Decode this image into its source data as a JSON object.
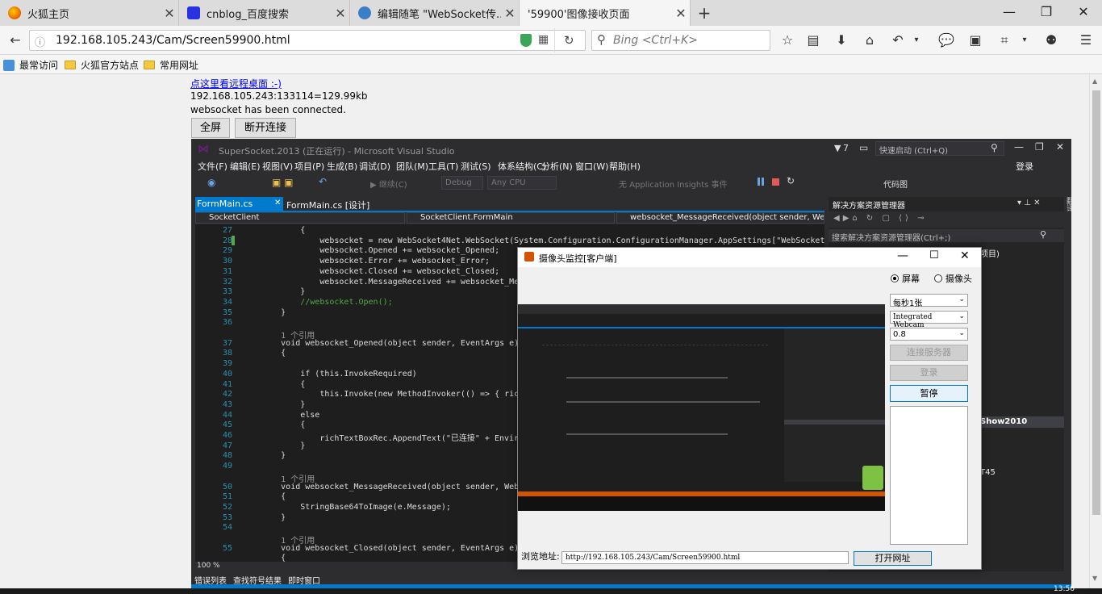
{
  "tabs": [
    {
      "title": "火狐主页",
      "color": "#e66000"
    },
    {
      "title": "cnblog_百度搜索",
      "color": "#2932e1"
    },
    {
      "title": "编辑随笔 \"WebSocket传...",
      "color": "#3b7ec8"
    },
    {
      "title": "'59900'图像接收页面",
      "color": "#cccccc"
    }
  ],
  "nav": {
    "url": "192.168.105.243/Cam/Screen59900.html",
    "search_placeholder": "Bing <Ctrl+K>"
  },
  "bookmarks": [
    "最常访问",
    "火狐官方站点",
    "常用网址"
  ],
  "page": {
    "link": "点这里看远程桌面 :-)",
    "stats": "192.168.105.243:133114=129.99kb",
    "status": "websocket has been connected.",
    "fullscreen_btn": "全屏",
    "disconnect_btn": "断开连接"
  },
  "vs": {
    "title": "SuperSocket.2013 (正在运行) - Microsoft Visual Studio",
    "notif_count": "7",
    "quicklaunch": "快速启动 (Ctrl+Q)",
    "login": "登录",
    "menu": [
      "文件(F)",
      "编辑(E)",
      "视图(V)",
      "项目(P)",
      "生成(B)",
      "调试(D)",
      "团队(M)",
      "工具(T)",
      "测试(S)",
      "体系结构(C)",
      "分析(N)",
      "窗口(W)",
      "帮助(H)"
    ],
    "toolbar": {
      "continue": "继续(C)",
      "config": "Debug",
      "platform": "Any CPU",
      "insights": "无 Application Insights 事件",
      "codemap": "代码图"
    },
    "doc_tabs": [
      "FormMain.cs",
      "FormMain.cs [设计]"
    ],
    "nav_bar": {
      "project": "SocketClient",
      "class": "SocketClient.FormMain",
      "member": "websocket_MessageReceived(object sender, Web"
    },
    "code_lines": [
      {
        "n": "27",
        "t": "            {"
      },
      {
        "n": "28",
        "t": "                websocket = new WebSocket4Net.WebSocket(System.Configuration.ConfigurationManager.AppSettings[\"WebSocketServerU"
      },
      {
        "n": "29",
        "t": "                websocket.Opened += websocket_Opened;"
      },
      {
        "n": "30",
        "t": "                websocket.Error += websocket_Error;"
      },
      {
        "n": "31",
        "t": "                websocket.Closed += websocket_Closed;"
      },
      {
        "n": "32",
        "t": "                websocket.MessageReceived += websocket_Messag"
      },
      {
        "n": "33",
        "t": "            }"
      },
      {
        "n": "34",
        "t": "            //websocket.Open();"
      },
      {
        "n": "35",
        "t": "        }"
      },
      {
        "n": "36",
        "t": ""
      },
      {
        "n": "",
        "t": "        1 个引用"
      },
      {
        "n": "37",
        "t": "        void websocket_Opened(object sender, EventArgs e)"
      },
      {
        "n": "38",
        "t": "        {"
      },
      {
        "n": "39",
        "t": ""
      },
      {
        "n": "40",
        "t": "            if (this.InvokeRequired)"
      },
      {
        "n": "41",
        "t": "            {"
      },
      {
        "n": "42",
        "t": "                this.Invoke(new MethodInvoker(() => { richTex"
      },
      {
        "n": "43",
        "t": "            }"
      },
      {
        "n": "44",
        "t": "            else"
      },
      {
        "n": "45",
        "t": "            {"
      },
      {
        "n": "46",
        "t": "                richTextBoxRec.AppendText(\"已连接\" + Environm"
      },
      {
        "n": "47",
        "t": "            }"
      },
      {
        "n": "48",
        "t": "        }"
      },
      {
        "n": "49",
        "t": ""
      },
      {
        "n": "",
        "t": "        1 个引用"
      },
      {
        "n": "50",
        "t": "        void websocket_MessageReceived(object sender, WebSock"
      },
      {
        "n": "51",
        "t": "        {"
      },
      {
        "n": "52",
        "t": "            StringBase64ToImage(e.Message);"
      },
      {
        "n": "53",
        "t": "        }"
      },
      {
        "n": "54",
        "t": ""
      },
      {
        "n": "",
        "t": "        1 个引用"
      },
      {
        "n": "55",
        "t": "        void websocket_Closed(object sender, EventArgs e)"
      },
      {
        "n": "",
        "t": "        {"
      }
    ],
    "zoom": "100 %",
    "bottom_tabs": [
      "错误列表",
      "查找符号结果",
      "即时窗口"
    ],
    "solution_explorer": {
      "title": "解决方案资源管理器",
      "search": "搜索解决方案资源管理器(Ctrl+;)",
      "visible_fragments": [
        "项目)",
        "Show2010",
        "T45"
      ]
    },
    "side_tab": "翻译"
  },
  "dialog": {
    "title": "摄像头监控[客户端]",
    "radio_screen": "屏幕",
    "radio_camera": "摄像头",
    "fps": "每秒1张",
    "device": "Integrated Webcam",
    "quality": "0.8",
    "connect_btn": "连接服务器",
    "login_btn": "登录",
    "pause_btn": "暂停",
    "url_label": "浏览地址:",
    "url_value": "http://192.168.105.243/Cam/Screen59900.html",
    "open_btn": "打开网址"
  },
  "taskbar_time": "13:56",
  "colors": {
    "vs_bg": "#1e1e1e",
    "vs_chrome": "#2d2d30",
    "vs_accent": "#007acc",
    "link": "#0000ee",
    "keyword": "#569cd6",
    "type": "#4ec9b0",
    "string": "#d69d85",
    "comment": "#57a64a"
  }
}
